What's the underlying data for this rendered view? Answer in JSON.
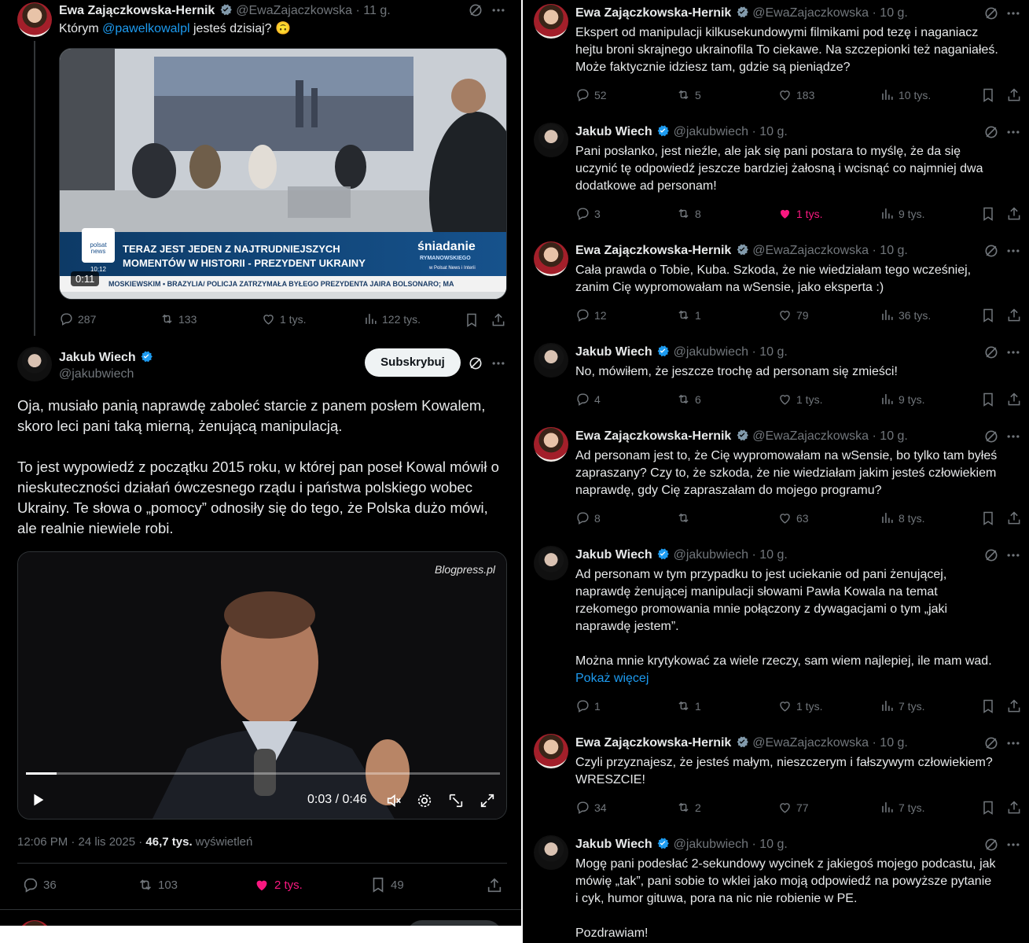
{
  "left": {
    "top_tweet": {
      "name": "Ewa Zajączkowska-Hernik",
      "handle": "@EwaZajaczkowska",
      "time": "· 11 g.",
      "text_before": "Którym ",
      "mention": "@pawelkowalpl",
      "text_after": " jesteś dzisiaj? 🙃",
      "video": {
        "duration": "0:11",
        "channel_logo": "polsat news",
        "clock": "10:12",
        "headline_line1": "TERAZ JEST JEDEN Z NAJTRUDNIEJSZYCH",
        "headline_line2": "MOMENTÓW W HISTORII - PREZYDENT UKRAINY",
        "show_name": "śniadanie",
        "show_sub": "RYMANOWSKIEGO",
        "show_tag": "w Polsat News i Interii",
        "ticker": "MOSKIEWSKIM  •  BRAZYLIA/ POLICJA ZATRZYMAŁA BYŁEGO PREZYDENTA JAIRA BOLSONARO; MA"
      },
      "stats": {
        "replies": "287",
        "reposts": "133",
        "likes": "1 tys.",
        "views": "122 tys."
      }
    },
    "main_tweet": {
      "name": "Jakub Wiech",
      "handle": "@jakubwiech",
      "subscribe": "Subskrybuj",
      "para1": "Oja, musiało panią naprawdę zaboleć starcie z panem posłem Kowalem, skoro leci pani taką mierną, żenującą manipulacją.",
      "para2": "To jest wypowiedź z początku 2015 roku, w której pan poseł Kowal mówił o nieskuteczności działań ówczesnego rządu i państwa polskiego wobec Ukrainy. Te słowa o „pomocy” odnosiły się do tego, że Polska dużo mówi, ale realnie niewiele robi.",
      "video": {
        "watermark": "Blogpress.pl",
        "time": "0:03 / 0:46",
        "progress": 0.065
      },
      "timestamp": "12:06 PM · 24 lis 2025 · ",
      "views_count": "46,7 tys.",
      "views_label": " wyświetleń",
      "stats": {
        "replies": "36",
        "reposts": "103",
        "likes": "2 tys.",
        "bookmarks": "49"
      }
    }
  },
  "right": {
    "replies": [
      {
        "author": "ewa",
        "name": "Ewa Zajączkowska-Hernik",
        "handle": "@EwaZajaczkowska",
        "time": "· 10 g.",
        "lines": [
          "Ekspert od manipulacji kilkusekundowymi filmikami pod tezę i naganiacz",
          "hejtu broni skrajnego ukrainofila To ciekawe. Na szczepionki też naganiałeś.",
          "Może faktycznie idziesz tam, gdzie są pieniądze?"
        ],
        "stats": {
          "replies": "52",
          "reposts": "5",
          "likes": "183",
          "views": "10 tys."
        },
        "liked": false
      },
      {
        "author": "jakub",
        "name": "Jakub Wiech",
        "handle": "@jakubwiech",
        "time": "· 10 g.",
        "lines": [
          "Pani posłanko, jest nieźle, ale jak się pani postara to myślę, że da się",
          "uczynić tę odpowiedź jeszcze bardziej żałosną i wcisnąć co najmniej dwa",
          "dodatkowe ad personam!"
        ],
        "stats": {
          "replies": "3",
          "reposts": "8",
          "likes": "1 tys.",
          "views": "9 tys."
        },
        "liked": true
      },
      {
        "author": "ewa",
        "name": "Ewa Zajączkowska-Hernik",
        "handle": "@EwaZajaczkowska",
        "time": "· 10 g.",
        "lines": [
          "Cała prawda o Tobie, Kuba. Szkoda, że nie wiedziałam tego wcześniej,",
          "zanim Cię wypromowałam na wSensie, jako eksperta :)"
        ],
        "stats": {
          "replies": "12",
          "reposts": "1",
          "likes": "79",
          "views": "36 tys."
        },
        "liked": false
      },
      {
        "author": "jakub",
        "name": "Jakub Wiech",
        "handle": "@jakubwiech",
        "time": "· 10 g.",
        "lines": [
          "No, mówiłem, że jeszcze trochę ad personam się zmieści!"
        ],
        "stats": {
          "replies": "4",
          "reposts": "6",
          "likes": "1 tys.",
          "views": "9 tys."
        },
        "liked": false
      },
      {
        "author": "ewa",
        "name": "Ewa Zajączkowska-Hernik",
        "handle": "@EwaZajaczkowska",
        "time": "· 10 g.",
        "lines": [
          "Ad personam jest to, że Cię wypromowałam na wSensie, bo tylko tam byłeś",
          "zapraszany? Czy to, że szkoda, że nie wiedziałam jakim jesteś człowiekiem",
          "naprawdę, gdy Cię zapraszałam do mojego programu?"
        ],
        "stats": {
          "replies": "8",
          "reposts": "",
          "likes": "63",
          "views": "8 tys."
        },
        "liked": false
      },
      {
        "author": "jakub",
        "name": "Jakub Wiech",
        "handle": "@jakubwiech",
        "time": "· 10 g.",
        "lines": [
          "Ad personam w tym przypadku to jest uciekanie od pani żenującej,",
          "naprawdę żenującej manipulacji słowami Pawła Kowala na temat",
          "rzekomego promowania mnie połączony z dywagacjami o tym „jaki",
          "naprawdę jestem”.",
          "",
          "Można mnie krytykować za wiele rzeczy, sam wiem najlepiej, ile mam wad."
        ],
        "show_more": "Pokaż więcej",
        "stats": {
          "replies": "1",
          "reposts": "1",
          "likes": "1 tys.",
          "views": "7 tys."
        },
        "liked": false
      },
      {
        "author": "ewa",
        "name": "Ewa Zajączkowska-Hernik",
        "handle": "@EwaZajaczkowska",
        "time": "· 10 g.",
        "lines": [
          "Czyli przyznajesz, że jesteś małym, nieszczerym i fałszywym człowiekiem?",
          "WRESZCIE!"
        ],
        "stats": {
          "replies": "34",
          "reposts": "2",
          "likes": "77",
          "views": "7 tys."
        },
        "liked": false
      },
      {
        "author": "jakub",
        "name": "Jakub Wiech",
        "handle": "@jakubwiech",
        "time": "· 10 g.",
        "lines": [
          "Mogę pani podesłać 2-sekundowy wycinek z jakiegoś mojego podcastu, jak",
          "mówię „tak”, pani sobie to wklei jako moją odpowiedź na powyższe pytanie",
          "i cyk, humor gituwa, pora na nic nie robienie w PE.",
          "",
          "Pozdrawiam!"
        ],
        "stats": null,
        "liked": false
      }
    ]
  },
  "colors": {
    "accent": "#1d9bf0",
    "like": "#f91880",
    "muted": "#71767b",
    "text": "#e7e9ea",
    "bg": "#000000"
  }
}
